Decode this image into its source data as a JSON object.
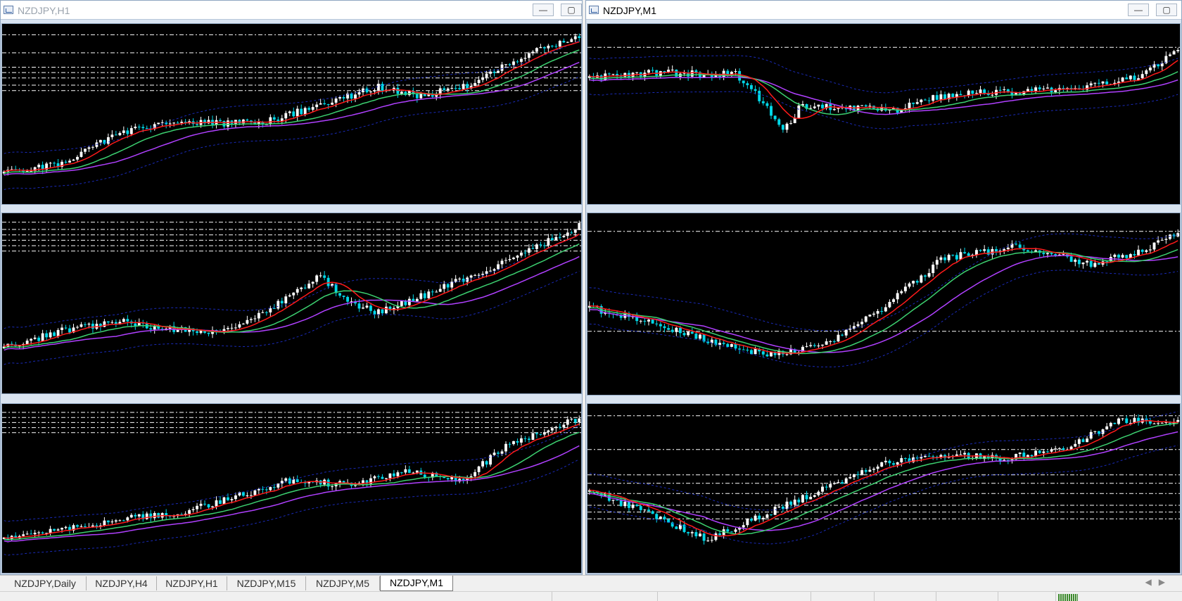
{
  "windows": {
    "left": {
      "title": "NZDJPY,H1",
      "active": false
    },
    "right": {
      "title": "NZDJPY,M1",
      "active": true
    }
  },
  "window_buttons": {
    "minimize": "—",
    "maximize": "▢"
  },
  "tabs": [
    {
      "label": "NZDJPY,Daily",
      "active": false
    },
    {
      "label": "NZDJPY,H4",
      "active": false
    },
    {
      "label": "NZDJPY,H1",
      "active": false
    },
    {
      "label": "NZDJPY,M15",
      "active": false
    },
    {
      "label": "NZDJPY,M5",
      "active": false
    },
    {
      "label": "NZDJPY,M1",
      "active": true
    }
  ],
  "tab_nav": {
    "prev": "◀",
    "next": "▶"
  },
  "colors": {
    "background": "#000000",
    "candle_up": "#ffffff",
    "candle_down": "#00d8e8",
    "ma_fast": "#ff1a1a",
    "ma_mid": "#3cd070",
    "ma_slow": "#b040ff",
    "bands": "#1a2ab8",
    "levels": "#ffffff"
  }
}
